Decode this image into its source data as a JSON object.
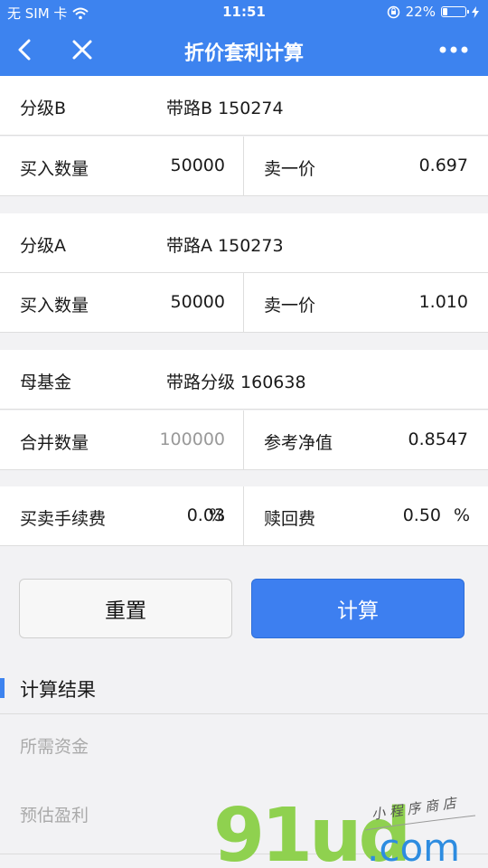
{
  "status_bar": {
    "carrier": "无 SIM 卡",
    "time": "11:51",
    "battery_text": "22%",
    "battery_level": 0.22
  },
  "nav": {
    "title": "折价套利计算"
  },
  "fund_b": {
    "label": "分级B",
    "name": "带路B 150274",
    "qty_label": "买入数量",
    "qty_value": "50000",
    "price_label": "卖一价",
    "price_value": "0.697"
  },
  "fund_a": {
    "label": "分级A",
    "name": "带路A 150273",
    "qty_label": "买入数量",
    "qty_value": "50000",
    "price_label": "卖一价",
    "price_value": "1.010"
  },
  "parent_fund": {
    "label": "母基金",
    "name": "带路分级 160638",
    "merge_label": "合并数量",
    "merge_value": "100000",
    "nav_label": "参考净值",
    "nav_value": "0.8547"
  },
  "fees": {
    "trade_label": "买卖手续费",
    "trade_value": "0.03",
    "redeem_label": "赎回费",
    "redeem_value": "0.50",
    "unit": "%"
  },
  "buttons": {
    "reset": "重置",
    "calculate": "计算"
  },
  "result": {
    "title": "计算结果",
    "funds_needed": "所需资金",
    "estimated_profit": "预估盈利"
  },
  "watermark": {
    "brand": "91ud.com",
    "tagline": "小程序商店"
  },
  "colors": {
    "primary": "#3d83ef",
    "watermark_green": "#8fd14f",
    "watermark_blue": "#2d8ce0"
  }
}
